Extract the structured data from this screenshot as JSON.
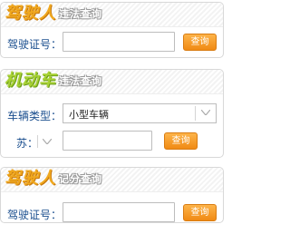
{
  "driver_violation": {
    "title_main": "驾驶人",
    "title_sub": "违法查询",
    "license_label": "驾驶证号：",
    "license_value": "",
    "query_button": "查询"
  },
  "vehicle_violation": {
    "title_main": "机动车",
    "title_sub": "违法查询",
    "vehicle_type_label": "车辆类型：",
    "vehicle_type_value": "小型车辆",
    "plate_prefix_label": "苏：",
    "plate_value": "",
    "query_button": "查询"
  },
  "driver_points": {
    "title_main": "驾驶人",
    "title_sub": "记分查询",
    "license_label": "驾驶证号：",
    "license_value": "",
    "query_button": "查询"
  },
  "icons": [
    "chevron-down-icon"
  ],
  "colors": {
    "accent_orange": "#f0a81e",
    "accent_green": "#a9d236",
    "label_blue": "#1b4f8f",
    "button_orange": "#f08a14"
  }
}
